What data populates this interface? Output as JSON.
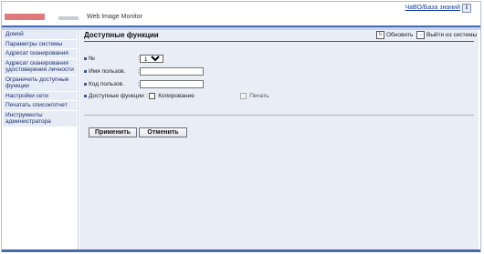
{
  "header": {
    "app_title": "Web Image Monitor",
    "help_link": "ЧаВО/База знаний",
    "info_icon": "i"
  },
  "sidebar": {
    "items": [
      {
        "label": "Домой"
      },
      {
        "label": "Параметры системы"
      },
      {
        "label": "Адресат сканирования"
      },
      {
        "label": "Адресат сканирования удостоверения личности"
      },
      {
        "label": "Ограничить доступные функции"
      },
      {
        "label": "Настройки сети"
      },
      {
        "label": "Печатать список/отчет"
      },
      {
        "label": "Инструменты администратора"
      }
    ]
  },
  "main": {
    "title": "Доступные функции",
    "refresh_label": "Обновить",
    "logout_label": "Выйти из системы",
    "form": {
      "number_label": "№",
      "number_value": "1",
      "number_options": [
        "1"
      ],
      "username_label": "Имя пользов.",
      "username_value": "",
      "usercode_label": "Код пользов.",
      "usercode_value": "",
      "functions_label": "Доступные функции",
      "copy_label": "Копирование",
      "print_label": "Печать"
    },
    "apply_label": "Применить",
    "cancel_label": "Отменить"
  },
  "colors": {
    "accent": "#4a6ab0",
    "sidebar_bg": "#e6ecf6",
    "main_bg": "#e8edf6",
    "logo": "#e07a7a"
  }
}
